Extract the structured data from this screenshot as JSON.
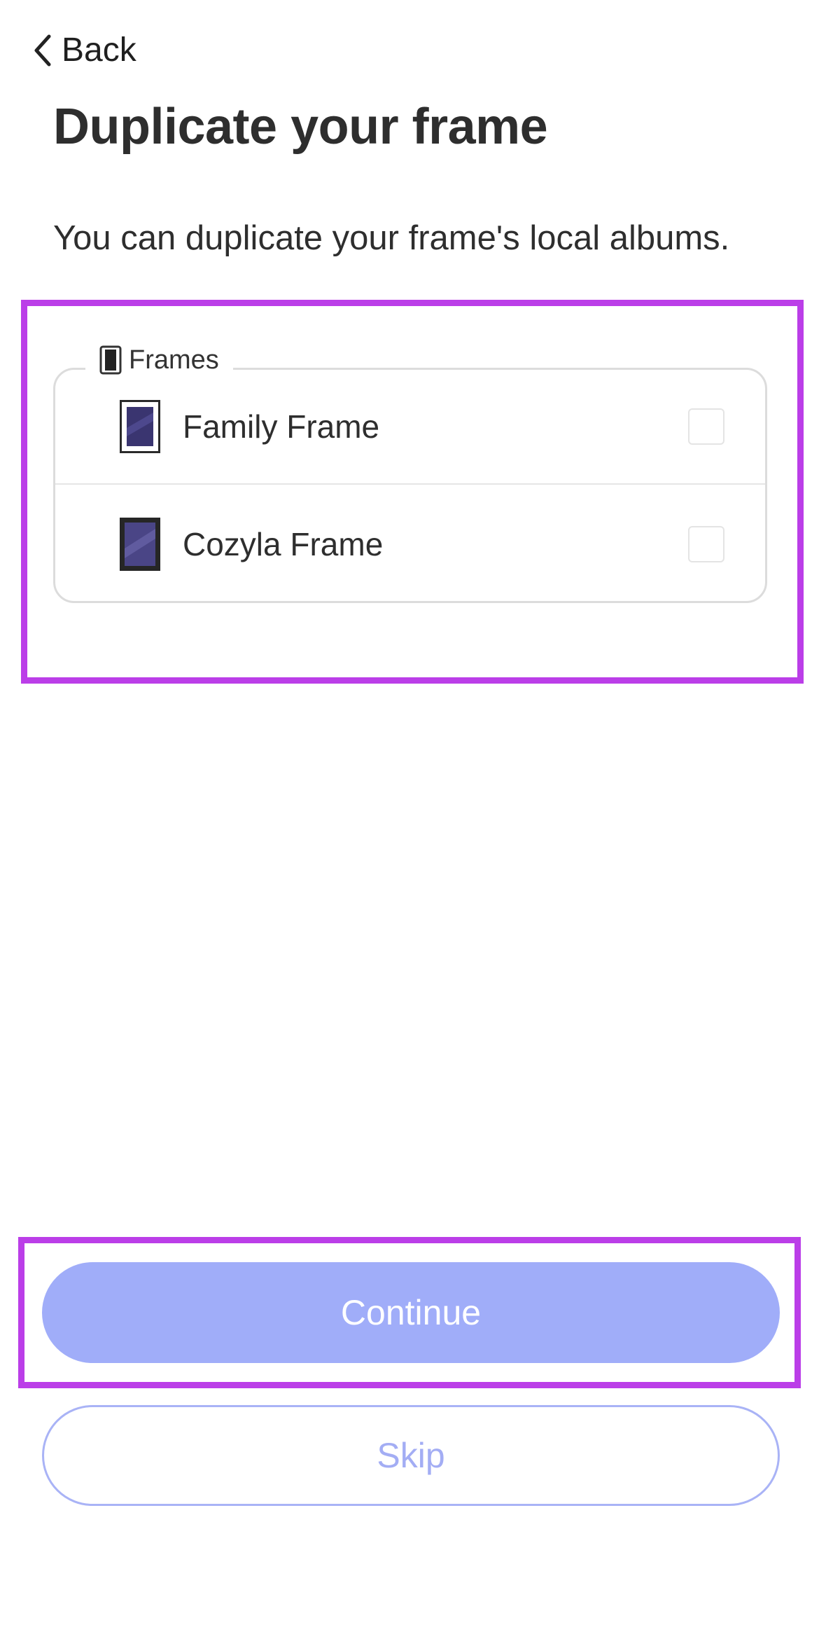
{
  "nav": {
    "back_label": "Back",
    "back_icon": "chevron-left-icon"
  },
  "header": {
    "title": "Duplicate your frame",
    "subtitle": "You can duplicate your frame's local albums."
  },
  "frames_group": {
    "legend": "Frames",
    "legend_icon": "frame-icon",
    "items": [
      {
        "name": "Family Frame",
        "icon": "white-frame-thumbnail-icon",
        "checked": false
      },
      {
        "name": "Cozyla Frame",
        "icon": "black-frame-thumbnail-icon",
        "checked": false
      }
    ]
  },
  "actions": {
    "continue_label": "Continue",
    "skip_label": "Skip"
  },
  "colors": {
    "highlight": "#bb3ee8",
    "primary_button": "#a0adf9",
    "skip_text": "#a3adf4",
    "skip_border": "#a9b3f6"
  }
}
